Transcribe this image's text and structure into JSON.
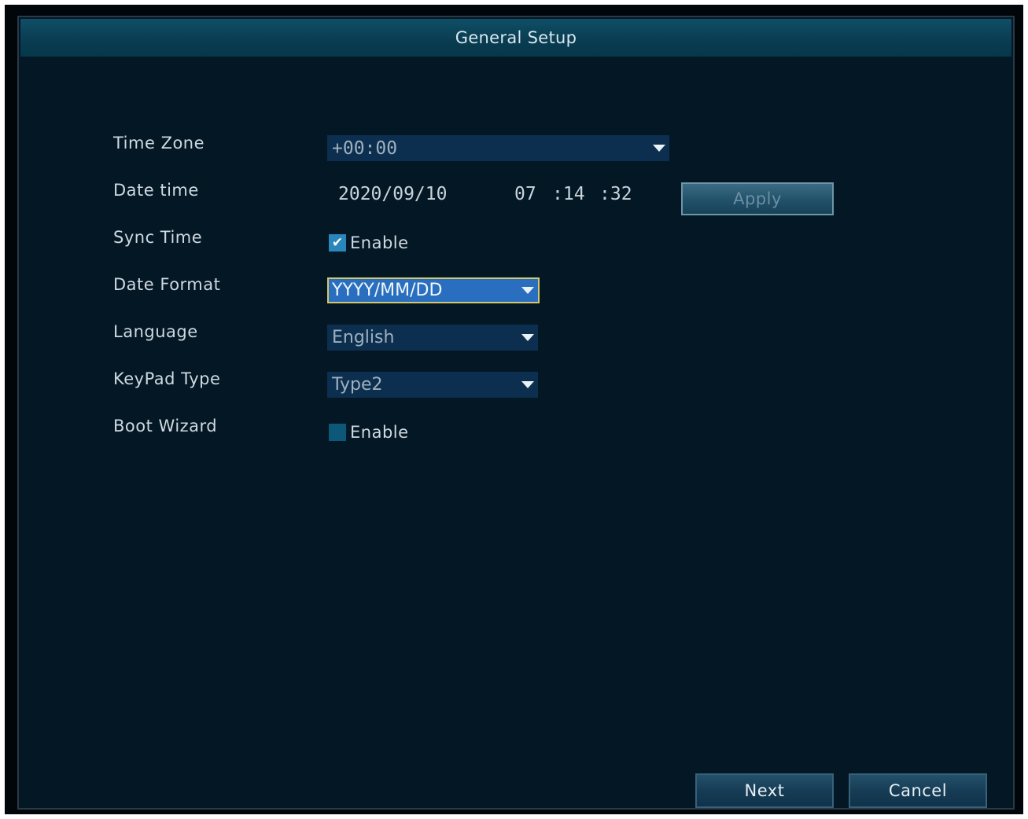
{
  "window": {
    "title": "General Setup"
  },
  "fields": {
    "time_zone": {
      "label": "Time Zone",
      "value": "+00:00"
    },
    "date_time": {
      "label": "Date time",
      "date": "2020/09/10",
      "hour": "07",
      "minute": ":14",
      "second": ":32",
      "apply_label": "Apply"
    },
    "sync_time": {
      "label": "Sync Time",
      "checkbox_label": "Enable",
      "checked": true
    },
    "date_format": {
      "label": "Date Format",
      "value": "YYYY/MM/DD"
    },
    "language": {
      "label": "Language",
      "value": "English"
    },
    "keypad_type": {
      "label": "KeyPad Type",
      "value": "Type2"
    },
    "boot_wizard": {
      "label": "Boot Wizard",
      "checkbox_label": "Enable",
      "checked": false
    }
  },
  "footer": {
    "next_label": "Next",
    "cancel_label": "Cancel"
  },
  "colors": {
    "background": "#031725",
    "title_bar": "#0a3d52",
    "focus_border": "#d4c66a",
    "focus_fill": "#2a6fbf"
  },
  "icons": {
    "dropdown": "triangle-down-icon",
    "check": "check-icon"
  }
}
